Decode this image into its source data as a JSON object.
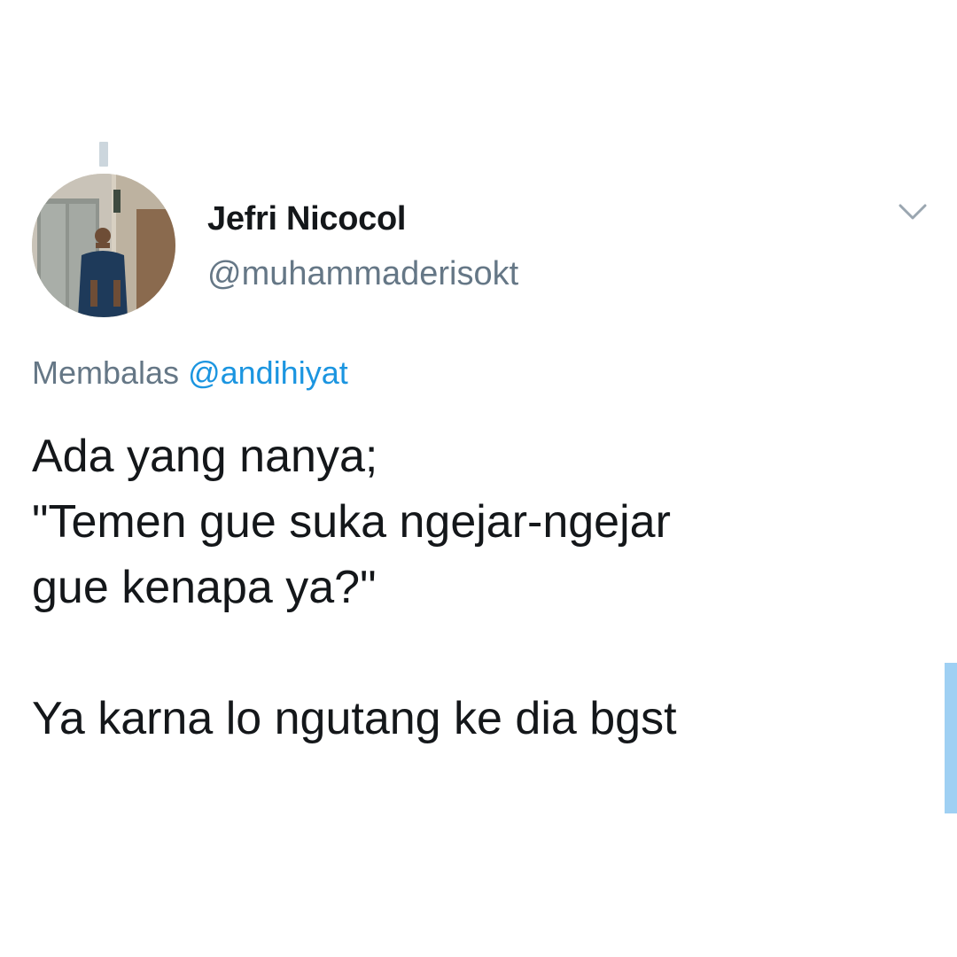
{
  "tweet": {
    "author": {
      "display_name": "Jefri Nicocol",
      "handle": "@muhammaderisokt",
      "avatar": "profile-photo"
    },
    "reply_to": {
      "prefix": "Membalas",
      "mention": "@andihiyat"
    },
    "text_lines": [
      "Ada yang nanya;",
      "\"Temen gue suka ngejar-ngejar",
      "gue kenapa ya?\"",
      "",
      "Ya karna lo ngutang ke dia bgst"
    ],
    "menu_icon": "chevron-down-icon"
  },
  "colors": {
    "text": "#14171a",
    "secondary": "#657786",
    "link": "#1b95e0",
    "thread_line": "#ccd6dd",
    "scroll_indicator": "#9fd0f3"
  }
}
